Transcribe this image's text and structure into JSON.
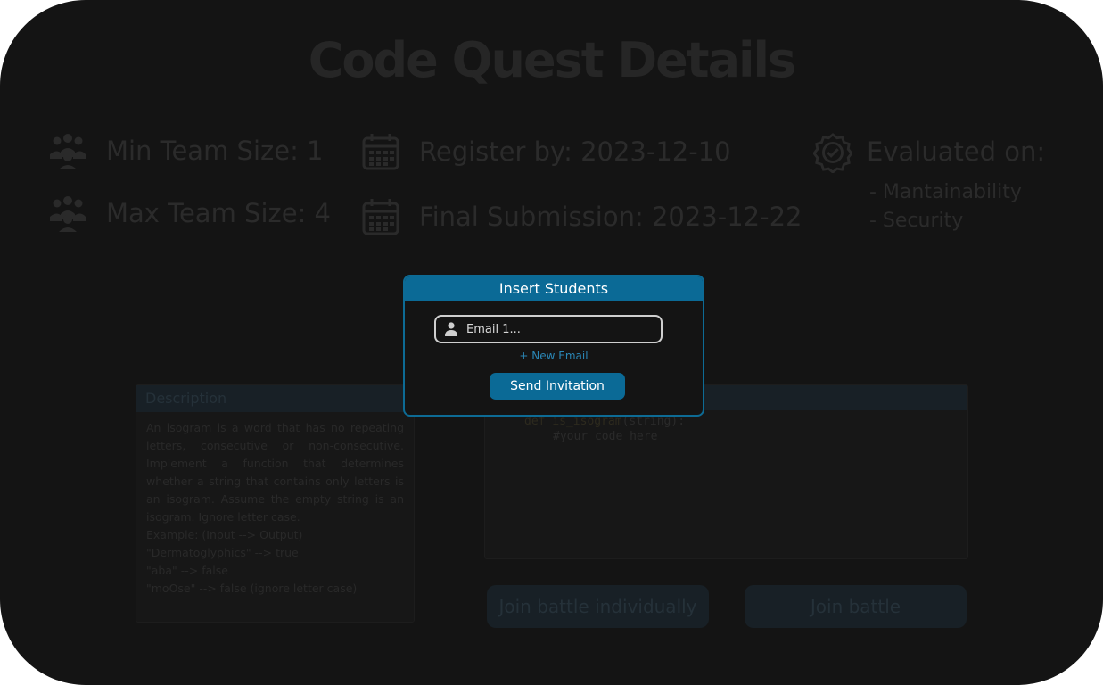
{
  "page": {
    "title": "Code Quest Details"
  },
  "info": {
    "min_team": "Min Team Size:  1",
    "max_team": "Max Team Size: 4",
    "register_by": "Register by: 2023-12-10",
    "final_submission": "Final Submission: 2023-12-22",
    "evaluated_on": "Evaluated on:",
    "criteria": [
      "- Mantainability",
      "- Security"
    ]
  },
  "description": {
    "header": "Description",
    "paragraph": "An isogram is a word that has no repeating letters, consecutive or non-consecutive. Implement a function that determines whether a string that contains only letters is an isogram. Assume the empty string is an isogram. Ignore letter case.",
    "lines": [
      "Example: (Input --> Output)",
      "\"Dermatoglyphics\" --> true",
      "\"aba\" --> false",
      "\"moOse\" --> false (ignore letter case)"
    ]
  },
  "code": {
    "keyword": "def",
    "func_name": "is_isogram",
    "params": "(string):",
    "comment": "#your code here"
  },
  "buttons": {
    "join_individually": "Join battle individually",
    "join_battle": "Join battle"
  },
  "modal": {
    "title": "Insert Students",
    "email_placeholder": "Email 1...",
    "new_email": "+ New Email",
    "send": "Send Invitation"
  },
  "colors": {
    "accent": "#0b6a96",
    "background": "#141414"
  },
  "icons": {
    "team": "team-icon",
    "calendar": "calendar-icon",
    "check_badge": "check-badge-icon",
    "user": "user-icon"
  }
}
